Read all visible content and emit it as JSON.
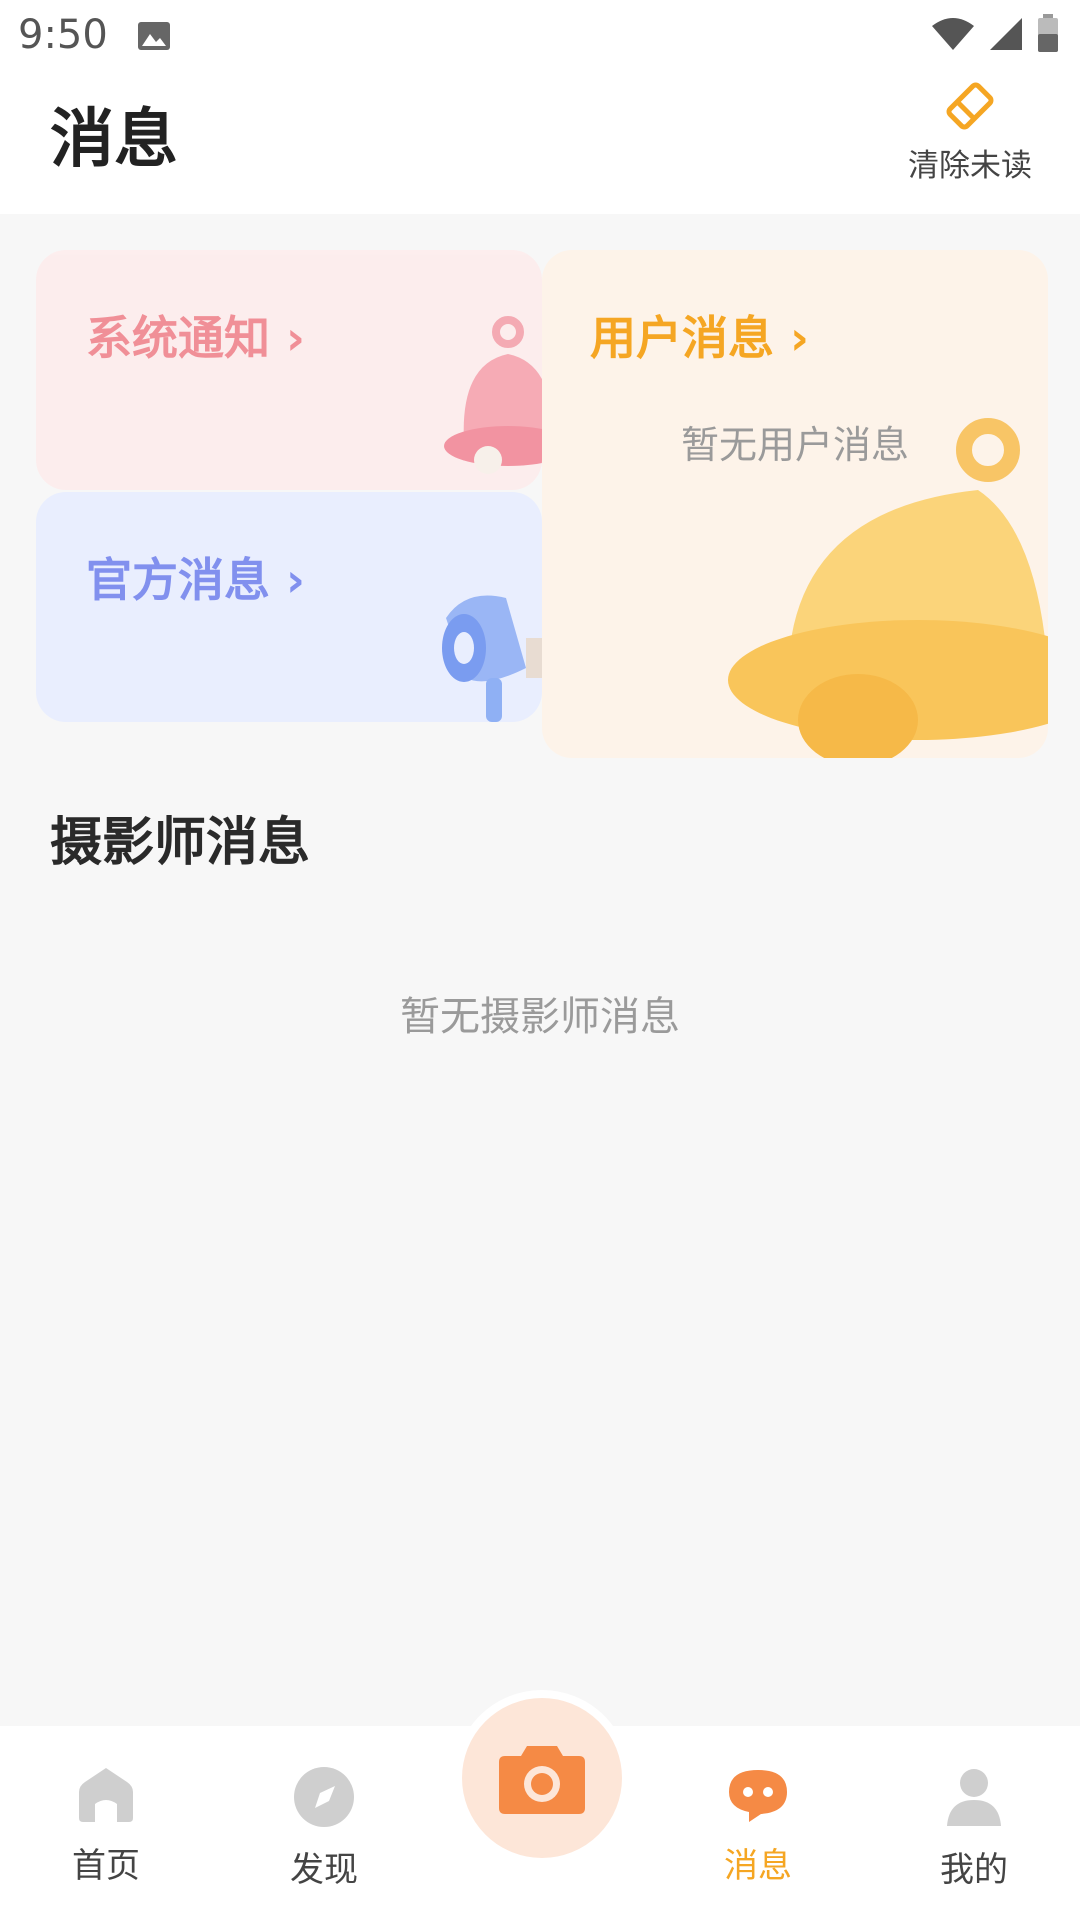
{
  "status_bar": {
    "time": "9:50"
  },
  "header": {
    "title": "消息",
    "clear_unread_label": "清除未读"
  },
  "cards": {
    "system_notice": {
      "title": "系统通知 ›"
    },
    "official_message": {
      "title": "官方消息 ›"
    },
    "user_message": {
      "title": "用户消息 ›",
      "empty_text": "暂无用户消息"
    }
  },
  "photographer": {
    "title": "摄影师消息",
    "empty_text": "暂无摄影师消息"
  },
  "tabbar": {
    "items": [
      {
        "label": "首页",
        "icon": "home-icon"
      },
      {
        "label": "发现",
        "icon": "compass-icon"
      },
      {
        "label": "消息",
        "icon": "chat-icon",
        "active": true
      },
      {
        "label": "我的",
        "icon": "user-icon"
      }
    ],
    "center_icon": "camera-icon"
  },
  "colors": {
    "accent": "#f5a623",
    "system_title": "#f08a92",
    "official_title": "#8190ee",
    "camera": "#f58a45"
  }
}
